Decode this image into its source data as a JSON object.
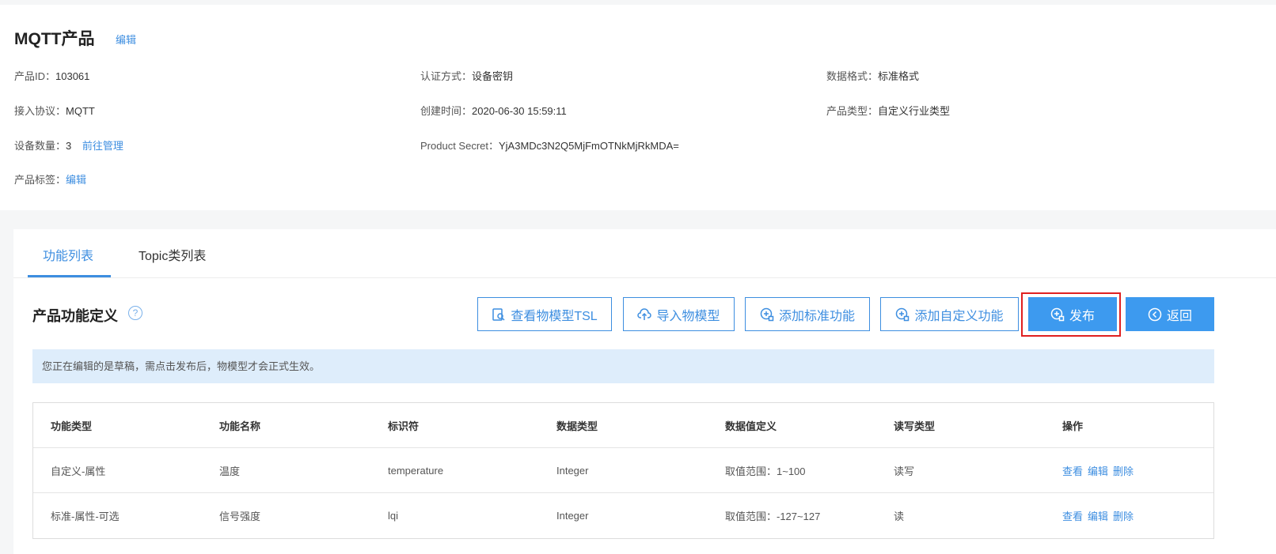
{
  "product": {
    "title": "MQTT产品",
    "edit_label": "编辑",
    "info": [
      {
        "label": "产品ID：",
        "value": "103061"
      },
      {
        "label": "认证方式：",
        "value": "设备密钥"
      },
      {
        "label": "数据格式：",
        "value": "标准格式"
      },
      {
        "label": "接入协议：",
        "value": "MQTT"
      },
      {
        "label": "创建时间：",
        "value": "2020-06-30 15:59:11"
      },
      {
        "label": "产品类型：",
        "value": "自定义行业类型"
      },
      {
        "label": "设备数量：",
        "value": "3"
      },
      {
        "label": "Product Secret：",
        "value": "YjA3MDc3N2Q5MjFmOTNkMjRkMDA="
      },
      {
        "label": "产品标签：",
        "value": ""
      }
    ],
    "manage_link": "前往管理",
    "tag_edit_link": "编辑"
  },
  "tabs": [
    {
      "label": "功能列表",
      "active": true
    },
    {
      "label": "Topic类列表",
      "active": false
    }
  ],
  "section": {
    "title": "产品功能定义",
    "help_glyph": "?"
  },
  "toolbar": {
    "view_tsl": "查看物模型TSL",
    "import_model": "导入物模型",
    "add_standard": "添加标准功能",
    "add_custom": "添加自定义功能",
    "publish": "发布",
    "back": "返回"
  },
  "notice": "您正在编辑的是草稿，需点击发布后，物模型才会正式生效。",
  "table": {
    "headers": [
      "功能类型",
      "功能名称",
      "标识符",
      "数据类型",
      "数据值定义",
      "读写类型",
      "操作"
    ],
    "rows": [
      [
        "自定义-属性",
        "温度",
        "temperature",
        "Integer",
        "取值范围：1~100",
        "读写"
      ],
      [
        "标准-属性-可选",
        "信号强度",
        "lqi",
        "Integer",
        "取值范围：-127~127",
        "读"
      ]
    ],
    "actions": [
      "查看",
      "编辑",
      "删除"
    ]
  },
  "colors": {
    "accent": "#3d8ee0",
    "primary_button": "#3d9aef",
    "notice_bg": "#deedfb",
    "highlight_border": "#e02020"
  }
}
